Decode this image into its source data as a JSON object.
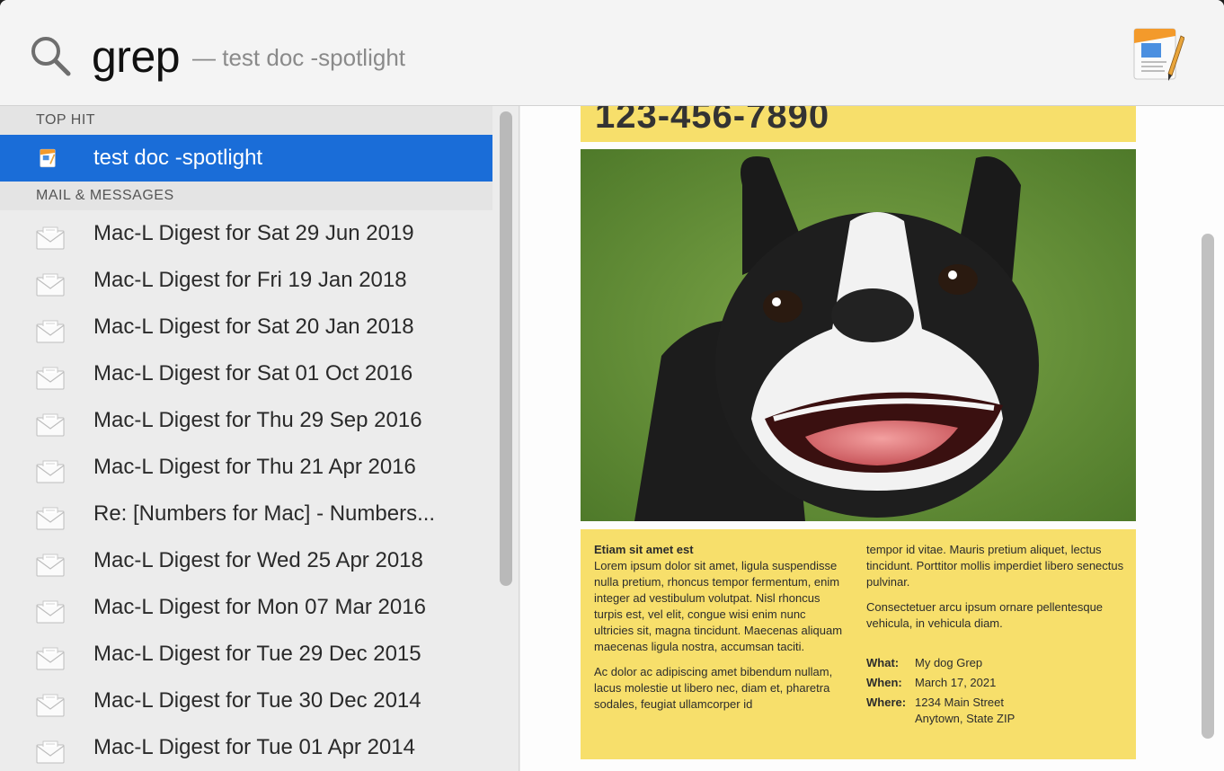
{
  "search": {
    "query": "grep",
    "hint": "— test doc -spotlight"
  },
  "results": {
    "sections": [
      {
        "header": "TOP HIT"
      },
      {
        "header": "MAIL & MESSAGES"
      }
    ],
    "top_hit": {
      "label": "test doc -spotlight",
      "icon": "pages-document-icon",
      "selected": true
    },
    "mail_items": [
      "Mac-L Digest for Sat 29 Jun 2019",
      "Mac-L Digest for Fri 19 Jan 2018",
      "Mac-L Digest for Sat 20 Jan 2018",
      "Mac-L Digest for Sat 01 Oct 2016",
      "Mac-L Digest for Thu 29 Sep 2016",
      "Mac-L Digest for Thu 21 Apr 2016",
      "Re: [Numbers for Mac] - Numbers...",
      "Mac-L Digest for Wed 25 Apr 2018",
      "Mac-L Digest for Mon 07 Mar 2016",
      "Mac-L Digest for Tue 29 Dec 2015",
      "Mac-L Digest for Tue 30 Dec 2014",
      "Mac-L Digest for Tue 01 Apr 2014"
    ]
  },
  "preview": {
    "phone": "123-456-7890",
    "heading": "Etiam sit amet est",
    "para1": "Lorem ipsum dolor sit amet, ligula suspendisse nulla pretium, rhoncus tempor fermentum, enim integer ad vestibulum volutpat. Nisl rhoncus turpis est, vel elit, congue wisi enim nunc ultricies sit, magna tincidunt. Maecenas aliquam maecenas ligula nostra, accumsan taciti.",
    "para2": "Ac dolor ac adipiscing amet bibendum nullam, lacus molestie ut libero nec, diam et, pharetra sodales, feugiat ullamcorper id",
    "para3": "tempor id vitae. Mauris pretium aliquet, lectus tincidunt. Porttitor mollis imperdiet libero senectus pulvinar.",
    "para4": "Consectetuer arcu ipsum ornare pellentesque vehicula, in vehicula diam.",
    "what_label": "What:",
    "what": "My dog Grep",
    "when_label": "When:",
    "when": "March 17, 2021",
    "where_label": "Where:",
    "where_line1": "1234 Main Street",
    "where_line2": "Anytown, State ZIP"
  },
  "colors": {
    "selection": "#1a6dd8",
    "flyer_yellow": "#f7df6b"
  }
}
